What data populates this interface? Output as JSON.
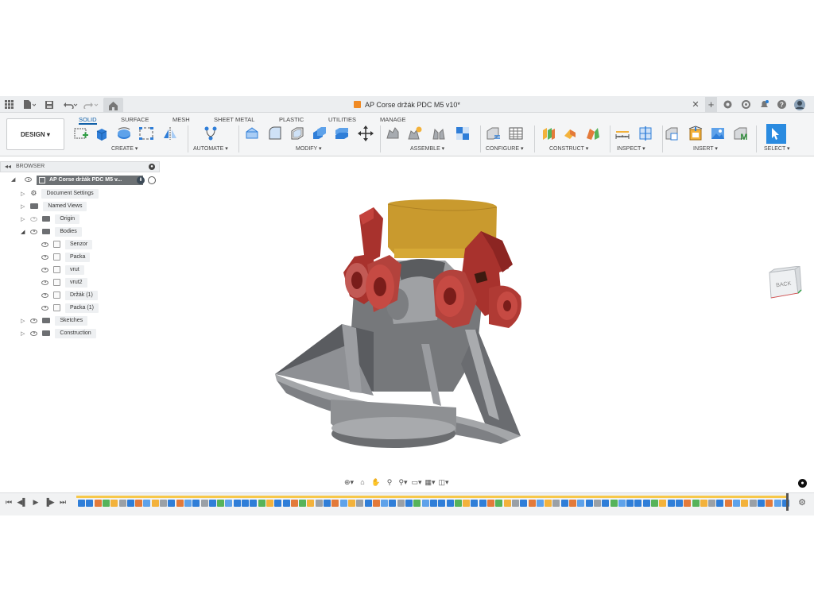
{
  "window": {
    "document_title": "AP Corse držák PDC M5 v10*"
  },
  "toolbar": {
    "workspace_label": "DESIGN ▾",
    "tabs": [
      {
        "label": "SOLID",
        "active": true
      },
      {
        "label": "SURFACE",
        "active": false
      },
      {
        "label": "MESH",
        "active": false
      },
      {
        "label": "SHEET METAL",
        "active": false
      },
      {
        "label": "PLASTIC",
        "active": false
      },
      {
        "label": "UTILITIES",
        "active": false
      },
      {
        "label": "MANAGE",
        "active": false
      }
    ],
    "groups": {
      "create": "CREATE ▾",
      "automate": "AUTOMATE ▾",
      "modify": "MODIFY ▾",
      "assemble": "ASSEMBLE ▾",
      "configure": "CONFIGURE ▾",
      "construct": "CONSTRUCT ▾",
      "inspect": "INSPECT ▾",
      "insert": "INSERT ▾",
      "select": "SELECT ▾"
    }
  },
  "browser": {
    "header": "BROWSER",
    "root": "AP Corse držák PDC M5 v...",
    "items": [
      {
        "label": "Document Settings",
        "type": "settings"
      },
      {
        "label": "Named Views",
        "type": "folder"
      },
      {
        "label": "Origin",
        "type": "folder"
      },
      {
        "label": "Bodies",
        "type": "folder"
      },
      {
        "label": "Senzor",
        "type": "body"
      },
      {
        "label": "Packa",
        "type": "body"
      },
      {
        "label": "vrut",
        "type": "body"
      },
      {
        "label": "vrut2",
        "type": "body"
      },
      {
        "label": "Držák (1)",
        "type": "body"
      },
      {
        "label": "Packa (1)",
        "type": "body"
      },
      {
        "label": "Sketches",
        "type": "folder"
      },
      {
        "label": "Construction",
        "type": "folder"
      }
    ]
  },
  "viewcube": {
    "face_label": "BACK"
  },
  "colors": {
    "accent": "#0f5fa8",
    "body_gray": "#8a8c8e",
    "body_red": "#a8322d",
    "sensor_gold": "#c99a2e",
    "timeline_highlight": "#f7c84a"
  }
}
